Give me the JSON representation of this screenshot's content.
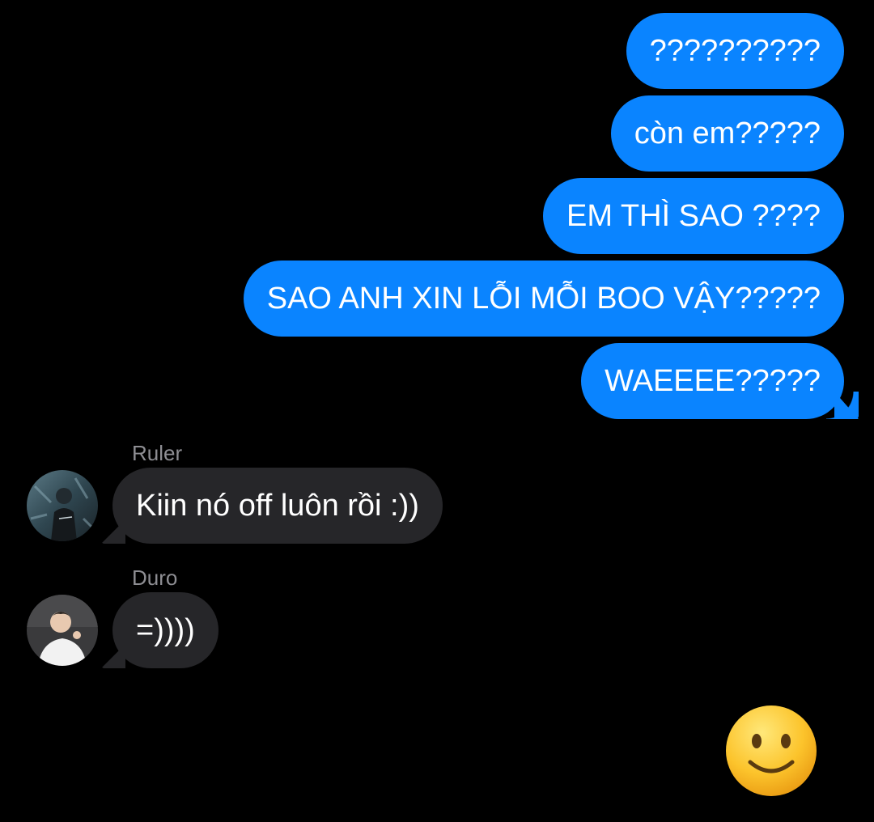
{
  "outgoing": [
    "??????????",
    "còn em?????",
    "EM THÌ SAO ????",
    "SAO ANH XIN LỖI MỖI BOO VẬY?????",
    "WAEEEE?????"
  ],
  "incoming": [
    {
      "sender": "Ruler",
      "text": "Kiin nó off luôn rồi :))"
    },
    {
      "sender": "Duro",
      "text": "=))))"
    }
  ],
  "reaction_emoji": "slightly-smiling-face",
  "colors": {
    "background": "#000000",
    "outgoing_bubble": "#0a84ff",
    "incoming_bubble": "#262629",
    "sender_name": "#8e8e93",
    "text": "#ffffff"
  }
}
